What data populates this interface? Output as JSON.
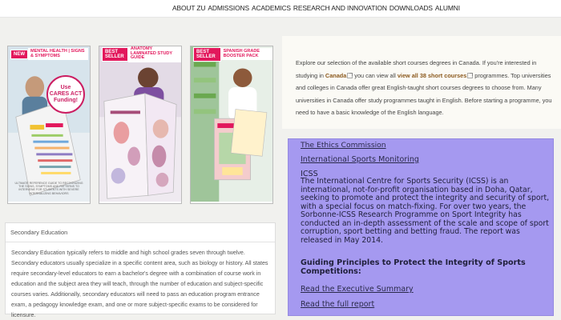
{
  "nav": {
    "items": [
      "About ZU",
      "Admissions",
      "Academics",
      "Research and Innovation",
      "Downloads",
      "Alumni"
    ]
  },
  "products": [
    {
      "badge": "New",
      "title": "Mental Health | Signs & Symptoms",
      "callout": [
        "Use",
        "CARES ACT",
        "Funding!"
      ],
      "caption": "Ultimate Reference Guide to Recognizing the Signs, Symptoms and Patterns to Intervene for Students with Severe Internalizing Behaviors"
    },
    {
      "badge": "Best Seller",
      "title": "Anatomy Laminated Study Guide"
    },
    {
      "badge": "Best Seller",
      "title": "Spanish Grade Booster Pack"
    }
  ],
  "secondary": {
    "title": "Secondary Education",
    "body": "Secondary Education typically refers to middle and high school grades seven through twelve. Secondary educators usually specialize in a specific content area, such as biology or history. All states require secondary-level educators to earn a bachelor's degree with a combination of course work in education and the subject area they will teach, through the number of education and subject-specific courses varies. Additionally, secondary educators will need to pass an education program entrance exam, a pedagogy knowledge exam, and one or more subject-specific exams to be considered for licensure."
  },
  "intro": {
    "t1": "Explore our selection of the available short courses degrees in Canada. If you're interested in studying in ",
    "link1": "Canada",
    "t2": " you can view all ",
    "link2": "view all 38 short courses",
    "t3": " programmes. Top universities and colleges in Canada offer great English-taught short courses degrees to choose from. Many universities in Canada offer study programmes taught in English. Before starting a programme, you need to have a basic knowledge of the English language."
  },
  "icss": {
    "link_ethics": "The Ethics Commission",
    "link_isn": "International Sports Monitoring",
    "heading": "ICSS",
    "body": "The International Centre for Sports Security (ICSS) is an international, not-for-profit organisation based in Doha, Qatar, seeking to promote and protect the integrity and security of sport, with a special focus on match-fixing. For over two years, the Sorbonne-ICSS Research Programme on Sport Integrity has conducted an in-depth assessment of the scale and scope of sport corruption, sport betting and betting fraud. The report was released in May 2014.",
    "guiding": "Guiding Principles to Protect the Integrity of Sports Competitions:",
    "link_summary": "Read the Executive Summary",
    "link_report": "Read the full report"
  }
}
